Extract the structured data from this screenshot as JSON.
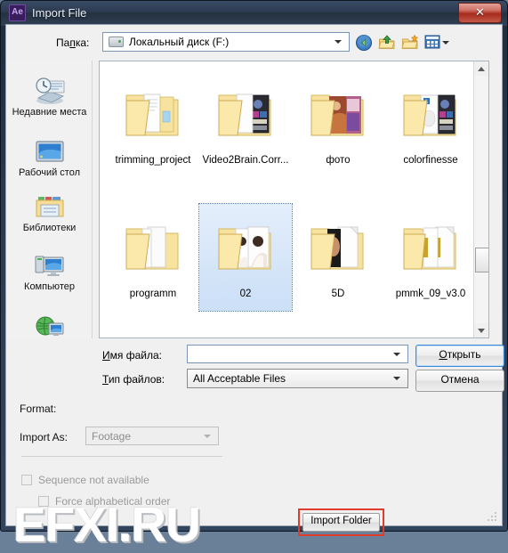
{
  "window": {
    "title": "Import File",
    "app_icon": "after-effects-icon",
    "app_icon_text": "Ae",
    "close_label": "✕"
  },
  "toolbar": {
    "path_label_pre": "Па",
    "path_label_underlined": "п",
    "path_label_post": "ка:",
    "path_label_full": "Папка:",
    "path_value": "Локальный диск (F:)",
    "buttons": [
      {
        "name": "back-button",
        "tooltip": "Назад"
      },
      {
        "name": "up-folder-button",
        "tooltip": "Вверх"
      },
      {
        "name": "new-folder-button",
        "tooltip": "Новая папка"
      },
      {
        "name": "views-button",
        "tooltip": "Виды"
      }
    ]
  },
  "places": {
    "items": [
      {
        "label": "Недавние места",
        "icon": "recent-places-icon"
      },
      {
        "label": "Рабочий стол",
        "icon": "desktop-icon"
      },
      {
        "label": "Библиотеки",
        "icon": "libraries-icon"
      },
      {
        "label": "Компьютер",
        "icon": "computer-icon"
      },
      {
        "label": "",
        "icon": "network-icon"
      }
    ]
  },
  "filelist": {
    "items": [
      {
        "name": "trimming_project",
        "type": "folder",
        "selected": false
      },
      {
        "name": "Video2Brain.Corr...",
        "type": "folder",
        "selected": false
      },
      {
        "name": "фото",
        "type": "folder",
        "selected": false
      },
      {
        "name": "colorfinesse",
        "type": "folder",
        "selected": false
      },
      {
        "name": "programm",
        "type": "folder",
        "selected": false
      },
      {
        "name": "02",
        "type": "folder",
        "selected": true
      },
      {
        "name": "5D",
        "type": "folder",
        "selected": false
      },
      {
        "name": "pmmk_09_v3.0",
        "type": "folder",
        "selected": false
      }
    ]
  },
  "form": {
    "filename_label": "Имя файла:",
    "filename_value": "",
    "filename_placeholder": "",
    "filetype_label": "Тип файлов:",
    "filetype_value": "All Acceptable Files",
    "open_button": "Открыть",
    "cancel_button": "Отмена"
  },
  "options": {
    "format_label": "Format:",
    "format_value": "",
    "import_as_label": "Import As:",
    "import_as_value": "Footage",
    "sequence_label": "Sequence not available",
    "sequence_checked": false,
    "force_label": "Force alphabetical order",
    "force_checked": false,
    "import_folder_button": "Import Folder"
  },
  "watermark": {
    "text": "EFXI.RU"
  },
  "colors": {
    "accent_red": "#e03c2e",
    "selection_blue": "#cbdff7",
    "titlebar": "#2c3a50",
    "panel": "#f0f0f0"
  }
}
